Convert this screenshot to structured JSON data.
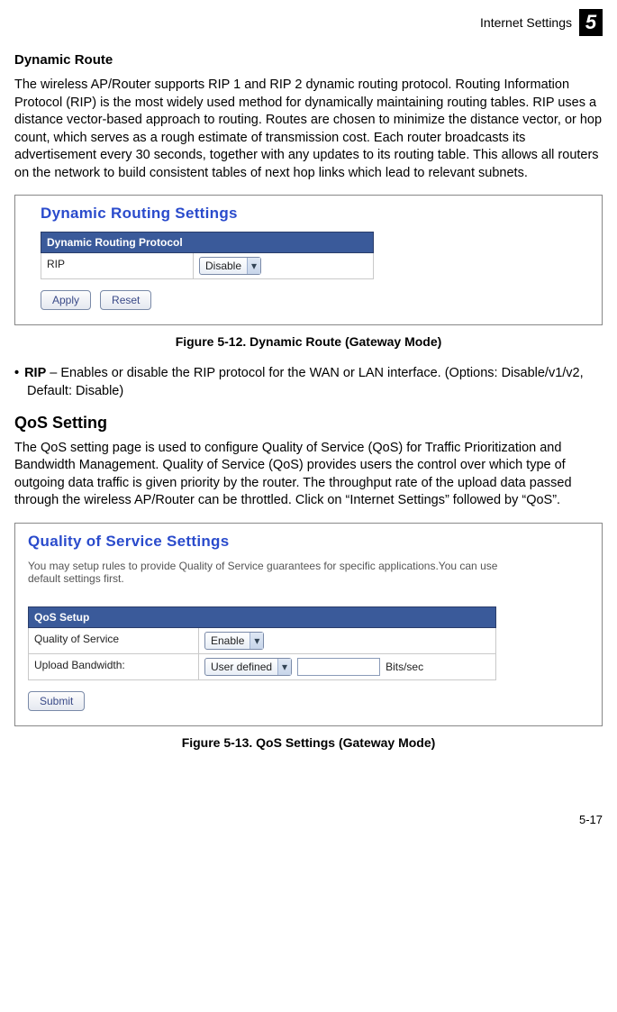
{
  "header": {
    "title": "Internet Settings",
    "chapter": "5"
  },
  "section1": {
    "heading": "Dynamic Route",
    "paragraph": "The wireless AP/Router supports RIP 1 and RIP 2 dynamic routing protocol. Routing Information Protocol (RIP) is the most widely used method for dynamically maintaining routing tables. RIP uses a distance vector-based approach to routing. Routes are chosen to minimize the distance vector, or hop count, which serves as a rough estimate of transmission cost. Each router broadcasts its advertisement every 30 seconds, together with any updates to its routing table. This allows all routers on the network to build consistent tables of next hop links which lead to relevant subnets."
  },
  "figure1": {
    "panel_title": "Dynamic Routing Settings",
    "bar": "Dynamic Routing Protocol",
    "row_label": "RIP",
    "row_value": "Disable",
    "buttons": {
      "apply": "Apply",
      "reset": "Reset"
    },
    "caption": "Figure 5-12.   Dynamic Route (Gateway Mode)"
  },
  "bullet1": {
    "term": "RIP",
    "text": " – Enables or disable the RIP protocol for the WAN or LAN interface. (Options: Disable/v1/v2, Default: Disable)"
  },
  "section2": {
    "heading": "QoS Setting",
    "paragraph": "The QoS setting page is used to configure Quality of Service (QoS) for Traffic Prioritization and Bandwidth Management. Quality of Service (QoS) provides users the control over which type of outgoing data traffic is given priority by the router. The throughput rate of the upload data passed through the wireless AP/Router can be throttled. Click on “Internet Settings” followed by “QoS”."
  },
  "figure2": {
    "panel_title": "Quality of Service Settings",
    "subtext": "You may setup rules to provide Quality of Service guarantees for specific applications.You can use default settings first.",
    "bar": "QoS Setup",
    "row1_label": "Quality of Service",
    "row1_value": "Enable",
    "row2_label": "Upload Bandwidth:",
    "row2_value": "User defined",
    "row2_unit": "Bits/sec",
    "submit": "Submit",
    "caption": "Figure 5-13.   QoS Settings (Gateway Mode)"
  },
  "page_num": "5-17"
}
